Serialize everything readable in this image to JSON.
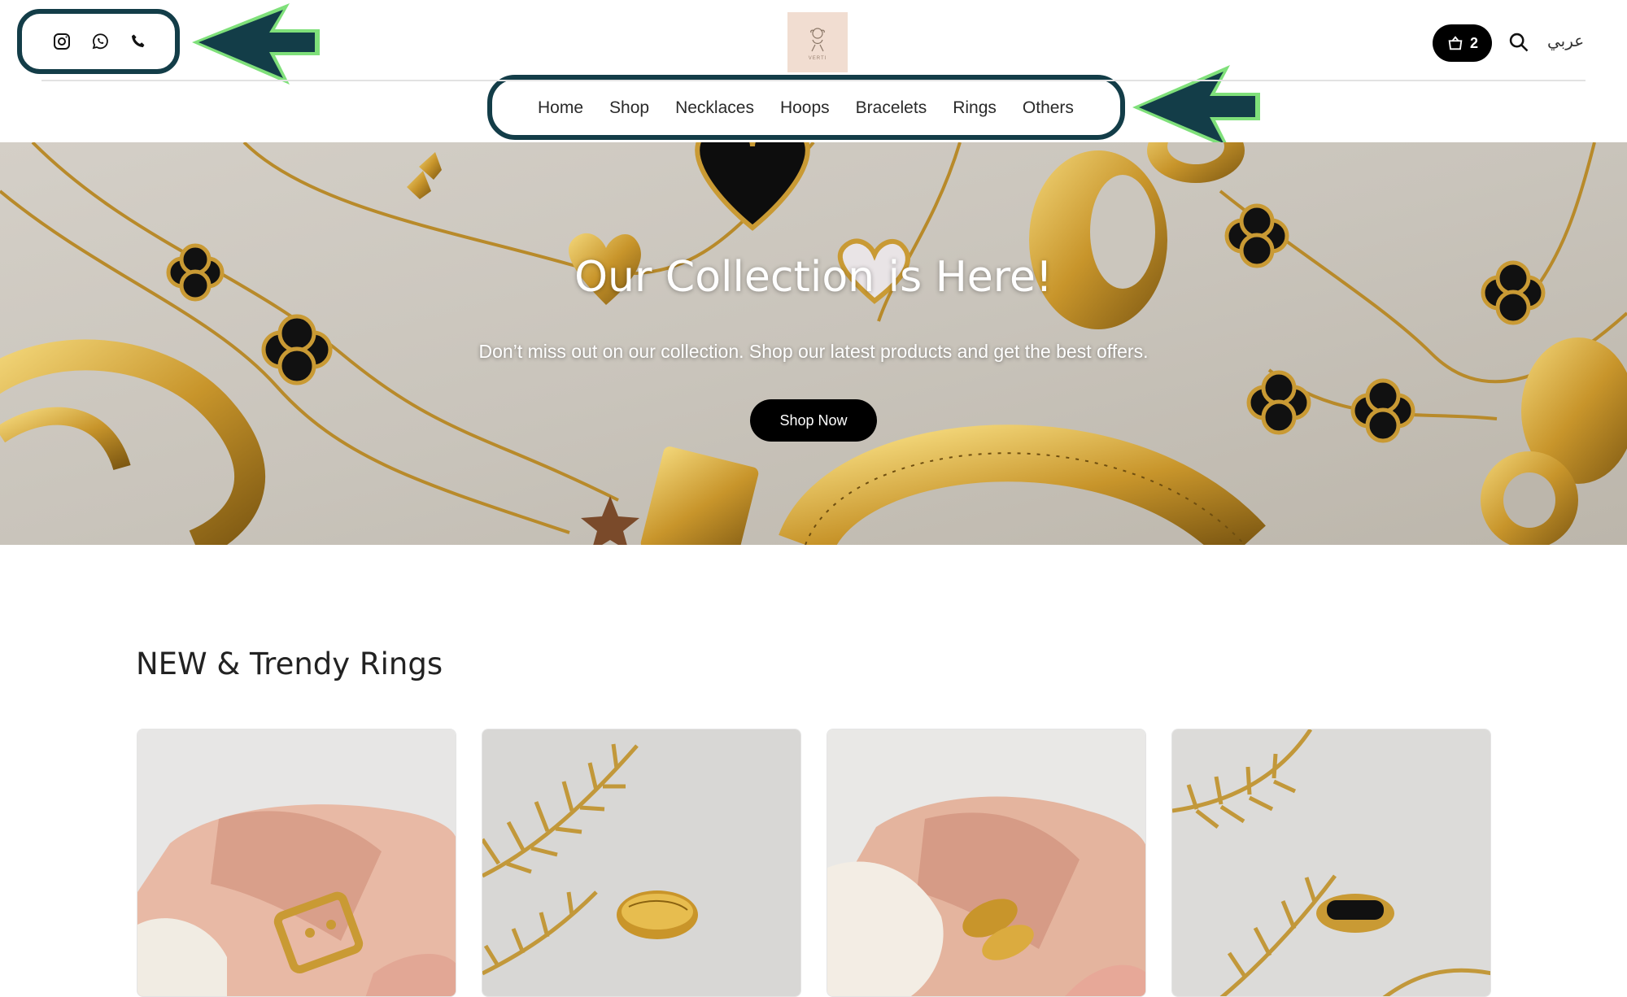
{
  "header": {
    "social_icons": [
      "instagram-icon",
      "whatsapp-icon",
      "phone-icon"
    ],
    "nav": [
      {
        "label": "Home"
      },
      {
        "label": "Shop"
      },
      {
        "label": "Necklaces"
      },
      {
        "label": "Hoops"
      },
      {
        "label": "Bracelets"
      },
      {
        "label": "Rings"
      },
      {
        "label": "Others"
      }
    ],
    "cart_count": "2",
    "language_label": "عربي"
  },
  "hero": {
    "title": "Our Collection is Here!",
    "subtitle": "Don’t miss out on our collection. Shop our latest products and get the best offers.",
    "button_label": "Shop Now"
  },
  "section": {
    "title": "NEW & Trendy Rings"
  },
  "colors": {
    "annotation_outline": "#133d48",
    "annotation_arrow_fill": "#133d48",
    "annotation_arrow_glow": "#7fe07a",
    "button_bg": "#000000",
    "logo_bg": "#f1ddd1"
  }
}
